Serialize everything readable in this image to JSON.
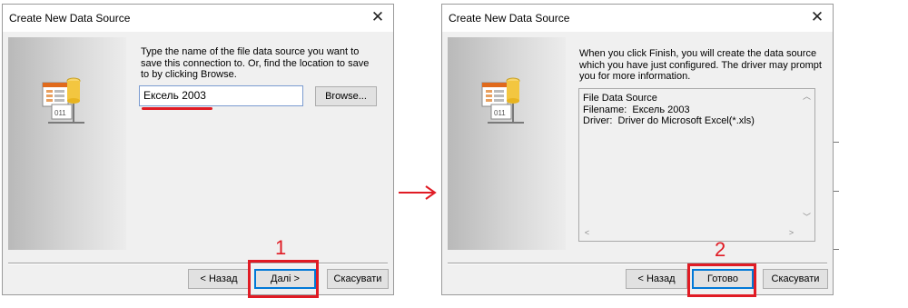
{
  "dialog1": {
    "title": "Create New Data Source",
    "description": "Type the name of the file data source you want to save this connection to. Or, find the location to save to by clicking Browse.",
    "name_value": "Ексель 2003",
    "browse_label": "Browse...",
    "back_label": "< Назад",
    "next_label": "Далі >",
    "cancel_label": "Скасувати"
  },
  "dialog2": {
    "title": "Create New Data Source",
    "description": "When you click Finish, you will create the data source which you have just configured. The driver may prompt you for more information.",
    "summary_text": "File Data Source\nFilename:  Ексель 2003\nDriver:  Driver do Microsoft Excel(*.xls)",
    "back_label": "< Назад",
    "finish_label": "Готово",
    "cancel_label": "Скасувати"
  },
  "annotations": {
    "step1": "1",
    "step2": "2",
    "highlight_color": "#e01b24"
  },
  "icons": {
    "close": "close-icon",
    "data_source": "database-icon",
    "arrow": "arrow-right-icon",
    "scroll_up": "chevron-up-icon",
    "scroll_down": "chevron-down-icon",
    "scroll_left": "chevron-left-icon",
    "scroll_right": "chevron-right-icon"
  }
}
